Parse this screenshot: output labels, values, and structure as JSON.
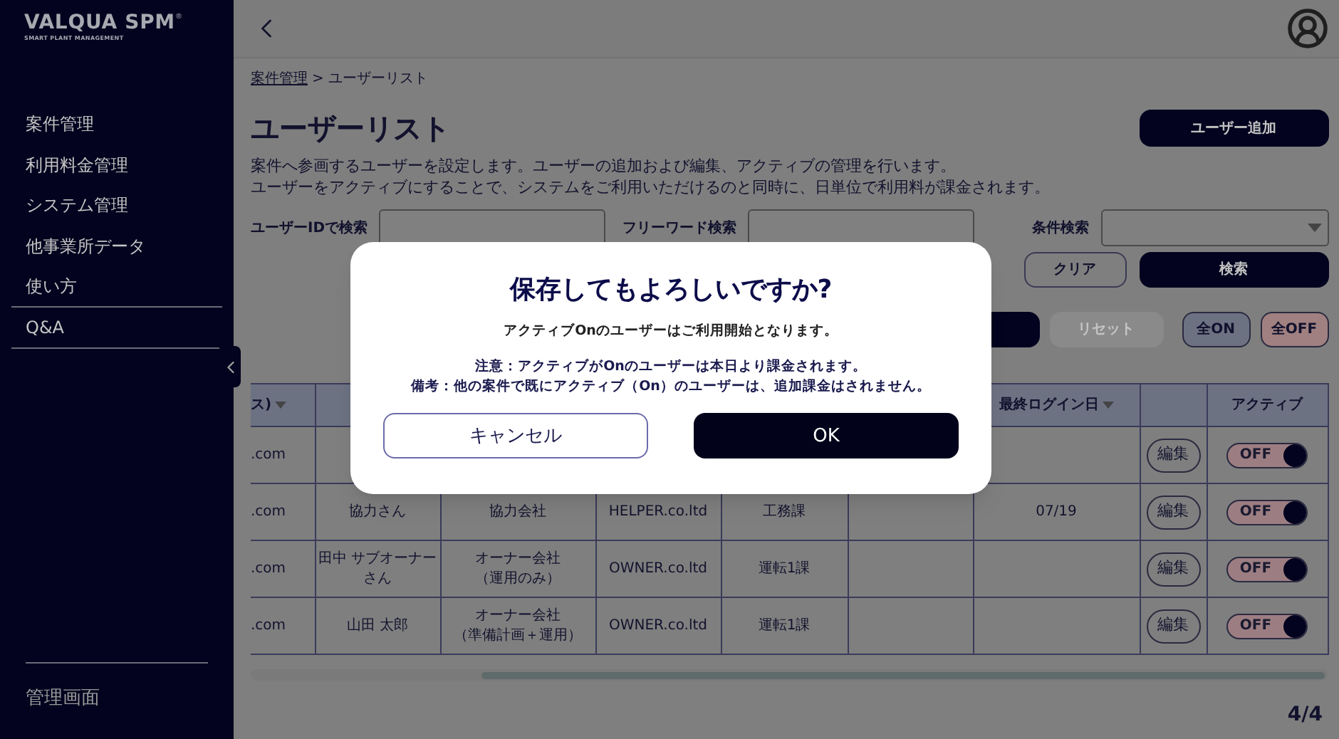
{
  "sidebar": {
    "logo": "VALQUA SPM",
    "logo_mark": "®",
    "tagline": "SMART PLANT MANAGEMENT",
    "items": [
      {
        "label": "案件管理",
        "divider_below": false
      },
      {
        "label": "利用料金管理",
        "divider_below": false
      },
      {
        "label": "システム管理",
        "divider_below": false
      },
      {
        "label": "他事業所データ",
        "divider_below": false
      },
      {
        "label": "使い方",
        "divider_below": true
      },
      {
        "label": "Q&A",
        "divider_below": true
      }
    ],
    "footer_item": "管理画面"
  },
  "breadcrumb": {
    "parent": "案件管理",
    "separator": ">",
    "current": "ユーザーリスト"
  },
  "title": "ユーザーリスト",
  "add_button": "ユーザー追加",
  "description": [
    "案件へ参画するユーザーを設定します。ユーザーの追加および編集、アクティブの管理を行います。",
    "ユーザーをアクティブにすることで、システムをご利用いただけるのと同時に、日単位で利用料が課金されます。"
  ],
  "search_fields": [
    {
      "label": "ユーザーIDで検索",
      "kind": "text"
    },
    {
      "label": "フリーワード検索",
      "kind": "text"
    },
    {
      "label": "条件検索",
      "kind": "select"
    }
  ],
  "clear_button": "クリア",
  "search_button": "検索",
  "bulk_actions": [
    {
      "kind": "primary",
      "disabled": false
    },
    {
      "kind": "reset",
      "label": "リセット",
      "disabled": true
    },
    {
      "kind": "all_on",
      "label": "全ON",
      "disabled": false
    },
    {
      "kind": "all_off",
      "label": "全OFF",
      "disabled": false
    }
  ],
  "table": {
    "columns": [
      {
        "label": "ス)",
        "sortable": true
      },
      {},
      {},
      {},
      {},
      {},
      {
        "label": "最終ログイン日",
        "sortable": true
      },
      {},
      {
        "label": "アクティブ",
        "sortable": false
      }
    ],
    "rows": [
      {
        "cells": [
          ".com",
          null,
          null,
          null,
          null,
          null,
          null
        ],
        "edit": "編集",
        "active": false,
        "toggle_label": "OFF"
      },
      {
        "cells": [
          ".com",
          "協力さん",
          "協力会社",
          "HELPER.co.ltd",
          "工務課",
          null,
          "07/19"
        ],
        "edit": "編集",
        "active": false,
        "toggle_label": "OFF"
      },
      {
        "cells": [
          ".com",
          "田中 サブオーナーさん",
          [
            "オーナー会社",
            "（運用のみ）"
          ],
          "OWNER.co.ltd",
          "運転1課",
          null,
          null
        ],
        "edit": "編集",
        "active": false,
        "toggle_label": "OFF"
      },
      {
        "cells": [
          ".com",
          "山田 太郎",
          [
            "オーナー会社",
            "（準備計画＋運用）"
          ],
          "OWNER.co.ltd",
          "運転1課",
          null,
          null
        ],
        "edit": "編集",
        "active": false,
        "toggle_label": "OFF"
      }
    ]
  },
  "pagination": "4/4",
  "dialog": {
    "title": "保存してもよろしいですか?",
    "message": "アクティブOnのユーザーはご利用開始となります。",
    "notes": [
      "注意：アクティブがOnのユーザーは本日より課金されます。",
      "備考：他の案件で既にアクティブ（On）のユーザーは、追加課金はされません。"
    ],
    "cancel": "キャンセル",
    "ok": "OK"
  }
}
